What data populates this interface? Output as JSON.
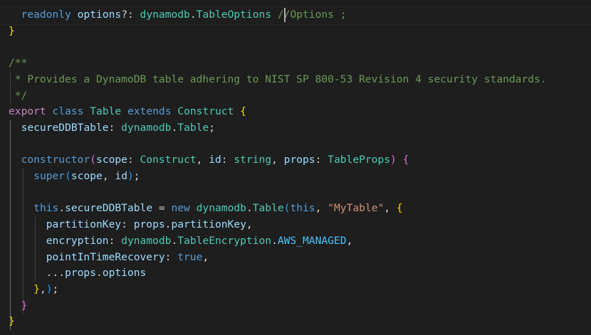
{
  "lines": [
    {
      "tokens": [
        {
          "t": "  ",
          "c": "pn"
        },
        {
          "t": "readonly",
          "c": "kw"
        },
        {
          "t": " ",
          "c": "pn"
        },
        {
          "t": "options",
          "c": "va"
        },
        {
          "t": "?: ",
          "c": "pn"
        },
        {
          "t": "dynamodb",
          "c": "ty"
        },
        {
          "t": ".",
          "c": "pn"
        },
        {
          "t": "TableOptions",
          "c": "ty"
        },
        {
          "t": " ",
          "c": "pn"
        },
        {
          "t": "//Options ;",
          "c": "com"
        }
      ]
    },
    {
      "tokens": [
        {
          "t": "}",
          "c": "b1"
        }
      ]
    },
    {
      "tokens": []
    },
    {
      "tokens": [
        {
          "t": "/**",
          "c": "com"
        }
      ]
    },
    {
      "tokens": [
        {
          "t": " * Provides a DynamoDB table adhering to NIST SP 800-53 Revision 4 security standards.",
          "c": "com"
        }
      ]
    },
    {
      "tokens": [
        {
          "t": " */",
          "c": "com"
        }
      ]
    },
    {
      "tokens": [
        {
          "t": "export",
          "c": "kw2"
        },
        {
          "t": " ",
          "c": "pn"
        },
        {
          "t": "class",
          "c": "kw"
        },
        {
          "t": " ",
          "c": "pn"
        },
        {
          "t": "Table",
          "c": "ty"
        },
        {
          "t": " ",
          "c": "pn"
        },
        {
          "t": "extends",
          "c": "kw"
        },
        {
          "t": " ",
          "c": "pn"
        },
        {
          "t": "Construct",
          "c": "ty"
        },
        {
          "t": " ",
          "c": "pn"
        },
        {
          "t": "{",
          "c": "b1"
        }
      ]
    },
    {
      "tokens": [
        {
          "t": "  ",
          "c": "pn"
        },
        {
          "t": "secureDDBTable",
          "c": "va"
        },
        {
          "t": ": ",
          "c": "pn"
        },
        {
          "t": "dynamodb",
          "c": "ty"
        },
        {
          "t": ".",
          "c": "pn"
        },
        {
          "t": "Table",
          "c": "ty"
        },
        {
          "t": ";",
          "c": "pn"
        }
      ]
    },
    {
      "tokens": []
    },
    {
      "tokens": [
        {
          "t": "  ",
          "c": "pn"
        },
        {
          "t": "constructor",
          "c": "kw"
        },
        {
          "t": "(",
          "c": "b2"
        },
        {
          "t": "scope",
          "c": "va"
        },
        {
          "t": ": ",
          "c": "pn"
        },
        {
          "t": "Construct",
          "c": "ty"
        },
        {
          "t": ", ",
          "c": "pn"
        },
        {
          "t": "id",
          "c": "va"
        },
        {
          "t": ": ",
          "c": "pn"
        },
        {
          "t": "string",
          "c": "ty"
        },
        {
          "t": ", ",
          "c": "pn"
        },
        {
          "t": "props",
          "c": "va"
        },
        {
          "t": ": ",
          "c": "pn"
        },
        {
          "t": "TableProps",
          "c": "ty"
        },
        {
          "t": ")",
          "c": "b2"
        },
        {
          "t": " ",
          "c": "pn"
        },
        {
          "t": "{",
          "c": "b2"
        }
      ]
    },
    {
      "tokens": [
        {
          "t": "    ",
          "c": "pn"
        },
        {
          "t": "super",
          "c": "kw"
        },
        {
          "t": "(",
          "c": "b3"
        },
        {
          "t": "scope",
          "c": "va"
        },
        {
          "t": ", ",
          "c": "pn"
        },
        {
          "t": "id",
          "c": "va"
        },
        {
          "t": ")",
          "c": "b3"
        },
        {
          "t": ";",
          "c": "pn"
        }
      ]
    },
    {
      "tokens": []
    },
    {
      "tokens": [
        {
          "t": "    ",
          "c": "pn"
        },
        {
          "t": "this",
          "c": "kw"
        },
        {
          "t": ".",
          "c": "pn"
        },
        {
          "t": "secureDDBTable",
          "c": "va"
        },
        {
          "t": " = ",
          "c": "pn"
        },
        {
          "t": "new",
          "c": "kw"
        },
        {
          "t": " ",
          "c": "pn"
        },
        {
          "t": "dynamodb",
          "c": "ty"
        },
        {
          "t": ".",
          "c": "pn"
        },
        {
          "t": "Table",
          "c": "ty"
        },
        {
          "t": "(",
          "c": "b3"
        },
        {
          "t": "this",
          "c": "kw"
        },
        {
          "t": ", ",
          "c": "pn"
        },
        {
          "t": "\"MyTable\"",
          "c": "str"
        },
        {
          "t": ", ",
          "c": "pn"
        },
        {
          "t": "{",
          "c": "b1"
        }
      ]
    },
    {
      "tokens": [
        {
          "t": "      ",
          "c": "pn"
        },
        {
          "t": "partitionKey",
          "c": "va"
        },
        {
          "t": ": ",
          "c": "pn"
        },
        {
          "t": "props",
          "c": "va"
        },
        {
          "t": ".",
          "c": "pn"
        },
        {
          "t": "partitionKey",
          "c": "va"
        },
        {
          "t": ",",
          "c": "pn"
        }
      ]
    },
    {
      "tokens": [
        {
          "t": "      ",
          "c": "pn"
        },
        {
          "t": "encryption",
          "c": "va"
        },
        {
          "t": ": ",
          "c": "pn"
        },
        {
          "t": "dynamodb",
          "c": "ty"
        },
        {
          "t": ".",
          "c": "pn"
        },
        {
          "t": "TableEncryption",
          "c": "ty"
        },
        {
          "t": ".",
          "c": "pn"
        },
        {
          "t": "AWS_MANAGED",
          "c": "const"
        },
        {
          "t": ",",
          "c": "pn"
        }
      ]
    },
    {
      "tokens": [
        {
          "t": "      ",
          "c": "pn"
        },
        {
          "t": "pointInTimeRecovery",
          "c": "va"
        },
        {
          "t": ": ",
          "c": "pn"
        },
        {
          "t": "true",
          "c": "kw"
        },
        {
          "t": ",",
          "c": "pn"
        }
      ]
    },
    {
      "tokens": [
        {
          "t": "      ",
          "c": "pn"
        },
        {
          "t": "...",
          "c": "op"
        },
        {
          "t": "props",
          "c": "va"
        },
        {
          "t": ".",
          "c": "pn"
        },
        {
          "t": "options",
          "c": "va"
        }
      ]
    },
    {
      "tokens": [
        {
          "t": "    ",
          "c": "pn"
        },
        {
          "t": "}",
          "c": "b1"
        },
        {
          "t": ",",
          "c": "pn"
        },
        {
          "t": ")",
          "c": "b3"
        },
        {
          "t": ";",
          "c": "pn"
        }
      ]
    },
    {
      "tokens": [
        {
          "t": "  ",
          "c": "pn"
        },
        {
          "t": "}",
          "c": "b2"
        }
      ]
    },
    {
      "tokens": [
        {
          "t": "}",
          "c": "b1"
        }
      ]
    }
  ]
}
